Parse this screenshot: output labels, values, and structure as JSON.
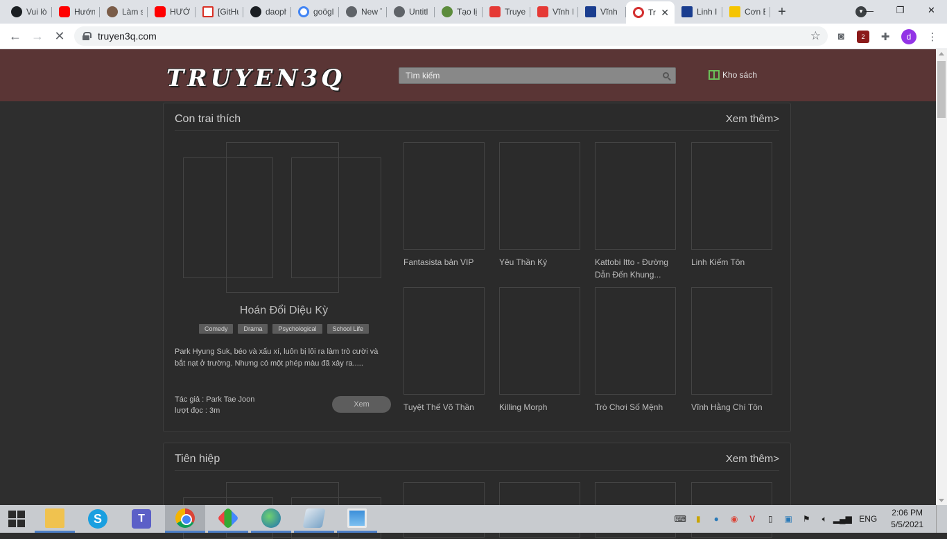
{
  "browser": {
    "tabs": [
      {
        "title": "Vui lò",
        "icon": "github-icon",
        "cls": "fav-gh"
      },
      {
        "title": "Hướn",
        "icon": "youtube-icon",
        "cls": "fav-yt"
      },
      {
        "title": "Làm s",
        "icon": "dog-avatar-icon",
        "cls": "fav-dog"
      },
      {
        "title": "HƯỚI",
        "icon": "youtube-icon",
        "cls": "fav-yt"
      },
      {
        "title": "[GitHu",
        "icon": "gmail-icon",
        "cls": "fav-gm"
      },
      {
        "title": "daoph",
        "icon": "github-icon",
        "cls": "fav-gh"
      },
      {
        "title": "goögl",
        "icon": "google-icon",
        "cls": "fav-g"
      },
      {
        "title": "New T",
        "icon": "globe-icon",
        "cls": "fav-globe"
      },
      {
        "title": "Untitl",
        "icon": "globe-icon",
        "cls": "fav-globe"
      },
      {
        "title": "Tạo lị",
        "icon": "green-app-icon",
        "cls": "fav-green"
      },
      {
        "title": "Truye",
        "icon": "heart-book-icon",
        "cls": "fav-heart"
      },
      {
        "title": "Vĩnh I",
        "icon": "heart-book-icon",
        "cls": "fav-heart"
      },
      {
        "title": "Vĩnh",
        "icon": "n-letter-icon",
        "cls": "fav-n"
      },
      {
        "title": "Tr",
        "icon": "truyen3q-icon",
        "cls": "fav-tq",
        "active": true
      },
      {
        "title": "Linh I",
        "icon": "n-letter-icon",
        "cls": "fav-n"
      },
      {
        "title": "Cơn E",
        "icon": "n-yellow-icon",
        "cls": "fav-ny"
      }
    ],
    "new_tab_symbol": "+",
    "close_symbol": "✕",
    "url": "truyen3q.com",
    "window_controls": {
      "minimize": "—",
      "restore": "❐",
      "close": "✕"
    },
    "extension_badge": "2",
    "profile_initial": "d"
  },
  "site": {
    "logo": "TRUYEN3Q",
    "search_placeholder": "Tìm kiếm",
    "library_link": "Kho sách"
  },
  "sections": [
    {
      "title": "Con trai thích",
      "see_more": "Xem thêm>",
      "featured": {
        "title": "Hoán Đổi Diệu Kỳ",
        "genres": [
          "Comedy",
          "Drama",
          "Psychological",
          "School Life"
        ],
        "description": "Park Hyung Suk, béo và xấu xí, luôn bị lôi ra làm trò cười và bắt nạt ở trường. Nhưng có một phép màu đã xảy ra.....",
        "author": "Tác giả : Park Tae Joon",
        "views": "lượt đọc : 3m",
        "read_button": "Xem"
      },
      "books": [
        "Fantasista bản VIP",
        "Yêu Thần Ký",
        "Kattobi Itto - Đường Dẫn Đến Khung...",
        "Linh Kiếm Tôn",
        "Tuyệt Thế Võ Thần",
        "Killing Morph",
        "Trò Chơi Số Mệnh",
        "Vĩnh Hằng Chí Tôn"
      ]
    },
    {
      "title": "Tiên hiệp",
      "see_more": "Xem thêm>"
    }
  ],
  "taskbar": {
    "apps": [
      {
        "name": "file-explorer-icon",
        "cls": "ic-folder",
        "state": "open"
      },
      {
        "name": "skype-icon",
        "cls": "ic-skype",
        "label": "S",
        "state": ""
      },
      {
        "name": "teams-icon",
        "cls": "ic-teams",
        "label": "T",
        "state": ""
      },
      {
        "name": "chrome-icon",
        "cls": "ic-chrome",
        "state": "active"
      },
      {
        "name": "snipping-tool-icon",
        "cls": "ic-snip",
        "state": "open"
      },
      {
        "name": "globe-app-icon",
        "cls": "ic-globe",
        "state": "open"
      },
      {
        "name": "notepad-icon",
        "cls": "ic-note",
        "state": "open"
      },
      {
        "name": "photos-icon",
        "cls": "ic-photo",
        "state": "open"
      }
    ],
    "language": "ENG",
    "time": "2:06 PM",
    "date": "5/5/2021"
  }
}
